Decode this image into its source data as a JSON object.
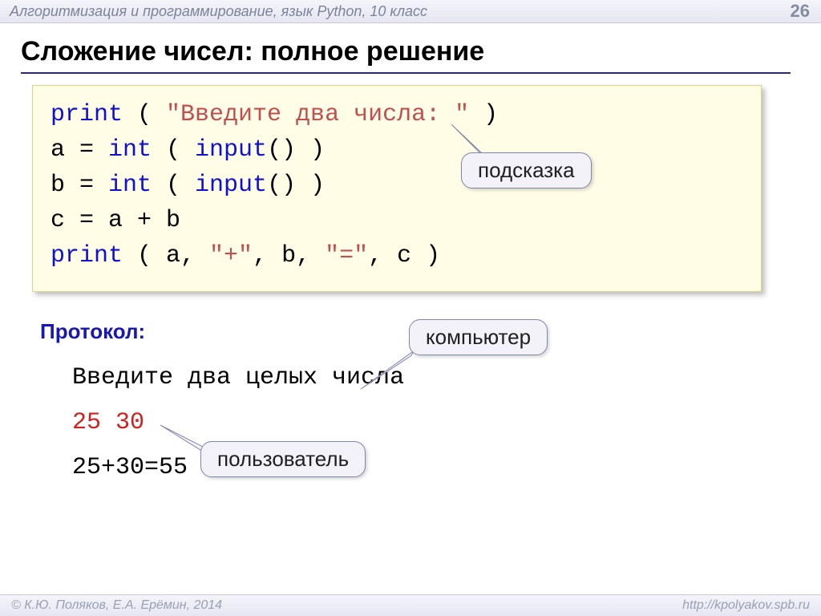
{
  "header": {
    "subject": "Алгоритмизация и программирование, язык Python, 10 класс",
    "page_number": "26"
  },
  "title": "Сложение чисел: полное решение",
  "code": {
    "line1": {
      "kw": "print",
      "open": " ( ",
      "str": "\"Введите два числа: \"",
      "close": " )"
    },
    "line2": {
      "lhs": "a = ",
      "kw": "int",
      "mid": " ( ",
      "fn": "input",
      "args": "() )"
    },
    "line3": {
      "lhs": "b = ",
      "kw": "int",
      "mid": " ( ",
      "fn": "input",
      "args": "() )"
    },
    "line4": "c = a + b",
    "line5": {
      "kw": "print",
      "open": " ( a, ",
      "s1": "\"+\"",
      "m1": ", b, ",
      "s2": "\"=\"",
      "close": ", c )"
    }
  },
  "callouts": {
    "hint": "подсказка",
    "computer": "компьютер",
    "user": "пользователь"
  },
  "protocol": {
    "label": "Протокол:",
    "line1": "Введите два целых числа",
    "line2": "25 30",
    "line3": "25+30=55"
  },
  "footer": {
    "left": "© К.Ю. Поляков, Е.А. Ерёмин, 2014",
    "right": "http://kpolyakov.spb.ru"
  }
}
